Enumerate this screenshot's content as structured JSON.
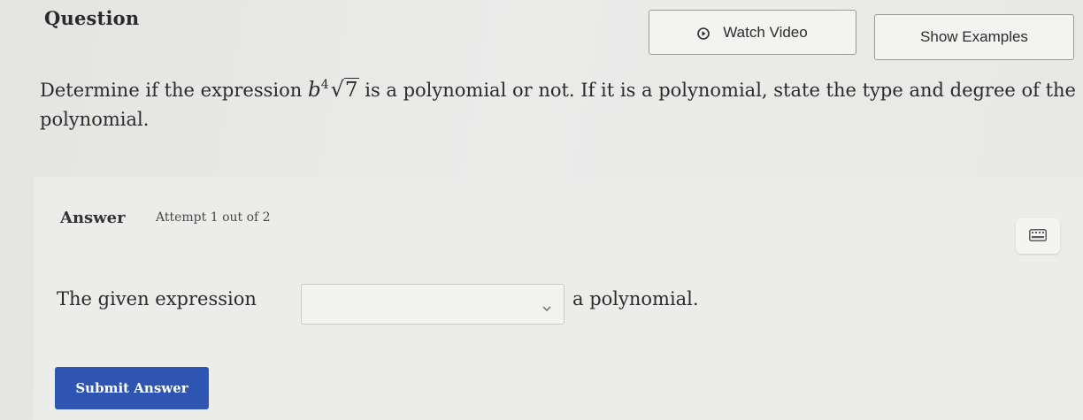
{
  "header": {
    "title": "Question",
    "watch_video_label": "Watch Video",
    "show_examples_label": "Show Examples"
  },
  "prompt": {
    "before": "Determine if the expression ",
    "math_base": "b",
    "math_exponent": "4",
    "math_radicand": "7",
    "after": " is a polynomial or not. If it is a polynomial, state the type and degree of the polynomial."
  },
  "answer": {
    "heading": "Answer",
    "attempt_text": "Attempt 1 out of 2",
    "sentence_before": "The given expression",
    "dropdown_value": "",
    "sentence_after": "a polynomial.",
    "submit_label": "Submit Answer"
  },
  "icons": {
    "watch_video": "play-circle-icon",
    "calculator": "calculator-icon",
    "dropdown": "chevron-down-icon"
  },
  "colors": {
    "submit_button": "#2f55b2",
    "background": "#e9e9e7"
  }
}
